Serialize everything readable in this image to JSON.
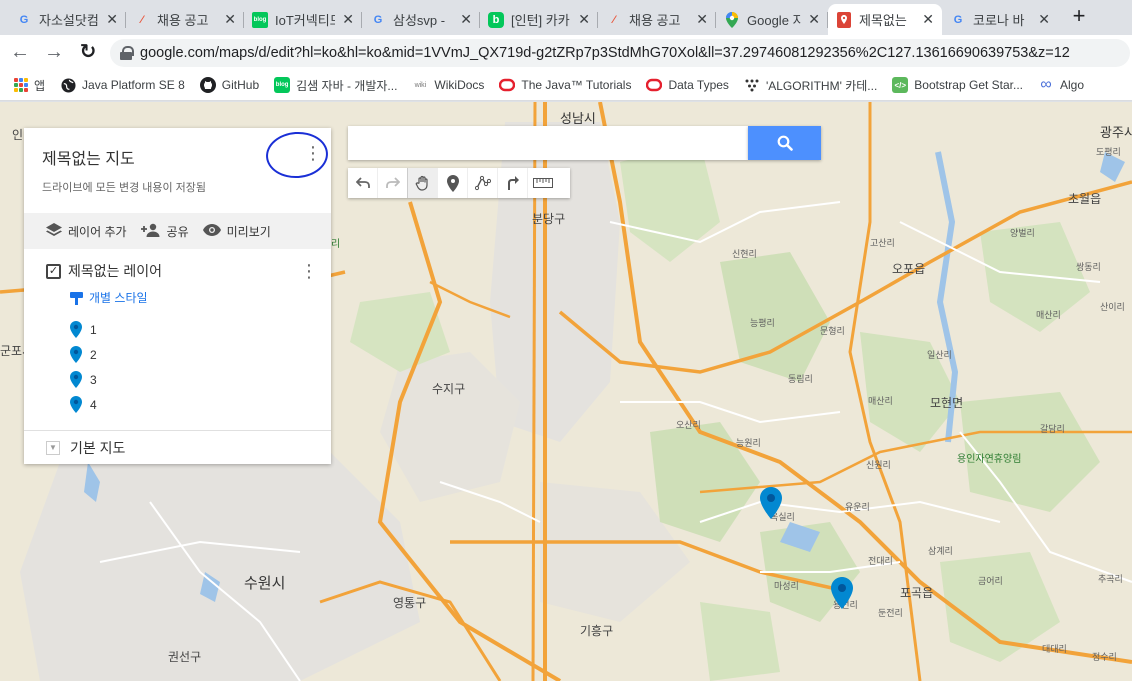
{
  "tabs": [
    {
      "title": "자소설닷컴",
      "favicon": "G",
      "favicon_color": "#4285f4"
    },
    {
      "title": "채용 공고",
      "favicon": "/",
      "favicon_color": "#e8563c"
    },
    {
      "title": "IoT커넥티드",
      "favicon": "blog",
      "favicon_color": "#03c75a"
    },
    {
      "title": "삼성svp -",
      "favicon": "G",
      "favicon_color": "#4285f4"
    },
    {
      "title": "[인턴] 카카",
      "favicon": "b",
      "favicon_color": "#03c75a"
    },
    {
      "title": "채용 공고",
      "favicon": "/",
      "favicon_color": "#e8563c"
    },
    {
      "title": "Google 지도",
      "favicon": "map",
      "favicon_color": "#34a853"
    },
    {
      "title": "제목없는",
      "favicon": "pin",
      "favicon_color": "#db4437"
    },
    {
      "title": "코로나 바",
      "favicon": "G",
      "favicon_color": "#4285f4"
    }
  ],
  "new_tab_label": "+",
  "nav": {
    "back": "←",
    "forward": "→",
    "reload": "↻"
  },
  "url": "google.com/maps/d/edit?hl=ko&hl=ko&mid=1VVmJ_QX719d-g2tZRp7p3StdMhG70Xol&ll=37.29746081292356%2C127.13616690639753&z=12",
  "bookmarks": [
    {
      "label": "앱",
      "icon": "apps-grid"
    },
    {
      "label": "Java Platform SE 8",
      "icon": "globe-icon"
    },
    {
      "label": "GitHub",
      "icon": "github-icon"
    },
    {
      "label": "김샘 자바 - 개발자...",
      "icon": "blog-icon"
    },
    {
      "label": "WikiDocs",
      "icon": "wikidocs-icon"
    },
    {
      "label": "The Java™ Tutorials",
      "icon": "oracle-icon"
    },
    {
      "label": "Data Types",
      "icon": "oracle-icon"
    },
    {
      "label": "'ALGORITHM' 카테...",
      "icon": "dots-icon"
    },
    {
      "label": "Bootstrap Get Star...",
      "icon": "code-icon"
    },
    {
      "label": "Algo",
      "icon": "infinity-icon"
    }
  ],
  "panel": {
    "title": "제목없는 지도",
    "status": "드라이브에 모든 변경 내용이 저장됨",
    "actions": {
      "add_layer": "레이어 추가",
      "share": "공유",
      "preview": "미리보기"
    },
    "layer": {
      "name": "제목없는 레이어",
      "checked": "✓",
      "style_link": "개별 스타일",
      "points": [
        "1",
        "2",
        "3",
        "4"
      ]
    },
    "basemap": "기본 지도"
  },
  "search": {
    "placeholder": "",
    "value": ""
  },
  "map_labels": {
    "seongnam": "성남시",
    "suwon": "수원시",
    "bundang": "분당구",
    "suji": "수지구",
    "yeongtong": "영통구",
    "giheung": "기흥구",
    "gwonseon": "권선구",
    "gwangju": "광주시",
    "chowol": "초월읍",
    "opo": "오포읍",
    "mohyeon": "모현면",
    "pogok": "포곡읍",
    "in": "인",
    "gunpo": "군포시",
    "ri": "리",
    "rest_forest": "용인자연휴양림",
    "sinhyeon": "신현리",
    "gosan": "고산리",
    "yangbeol": "양벌리",
    "doping": "도평리",
    "neungpyeong": "능평리",
    "munhyeong": "문형리",
    "dongrim": "동림리",
    "ilsan": "일산리",
    "maesan": "매산리",
    "osan": "오산리",
    "neungwon": "능원리",
    "galdam": "갈담리",
    "sinwon": "신원리",
    "yuun": "유운리",
    "jeondae": "전대리",
    "samgye": "삼계리",
    "masung": "마성리",
    "dunjeon": "둔전리",
    "geumeo": "금어리",
    "chugok": "추곡리",
    "daedae": "대대리",
    "jeongsu": "정수리",
    "ssangdong": "쌍동리",
    "sani": "산이리",
    "okjil": "옥실리",
    "yongjeon": "용전리",
    "maesan2": "매산리"
  },
  "markers": [
    {
      "label": "3",
      "color": "#0288d1"
    },
    {
      "label": "4",
      "color": "#0288d1"
    }
  ]
}
